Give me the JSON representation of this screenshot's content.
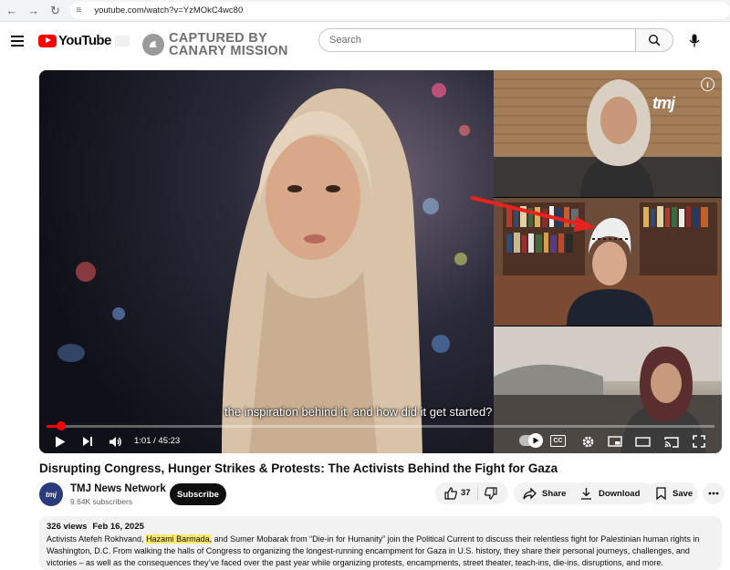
{
  "browser": {
    "url": "youtube.com/watch?v=YzMOkC4wc80"
  },
  "header": {
    "logo_text": "YouTube",
    "watermark_line1": "CAPTURED BY",
    "watermark_line2": "CANARY MISSION",
    "search_placeholder": "Search"
  },
  "player": {
    "caption": "the inspiration behind it, and how did it get started?",
    "time": "1:01 / 45:23",
    "progress": 0.0224,
    "cc_label": "CC",
    "channel_watermark": "tmj",
    "info_label": "i"
  },
  "video": {
    "title": "Disrupting Congress, Hunger Strikes & Protests: The Activists Behind the Fight for Gaza",
    "channel_name": "TMJ News Network",
    "subscribers": "9.64K subscribers",
    "subscribe_label": "Subscribe",
    "avatar_text": "tmj",
    "likes": "37",
    "share_label": "Share",
    "download_label": "Download",
    "save_label": "Save"
  },
  "description": {
    "views": "326 views",
    "date": "Feb 16, 2025",
    "text_before": "Activists Atefeh Rokhvand, ",
    "highlight": "Hazami Barmada,",
    "text_after": " and Sumer Mobarak from “Die-in for Humanity” join the Political Current to discuss their relentless fight for Palestinian human rights in Washington, D.C. From walking the halls of Congress to organizing the longest-running encampment for Gaza in U.S. history, they share their personal journeys, challenges, and victories – as well as the consequences they’ve faced over the past year while organizing protests, encampments, street theater, teach-ins, die-ins, disruptions, and more."
  },
  "colors": {
    "brand_red": "#ff0000",
    "highlight": "#fbe96b",
    "annotation_arrow": "#e8231f"
  }
}
